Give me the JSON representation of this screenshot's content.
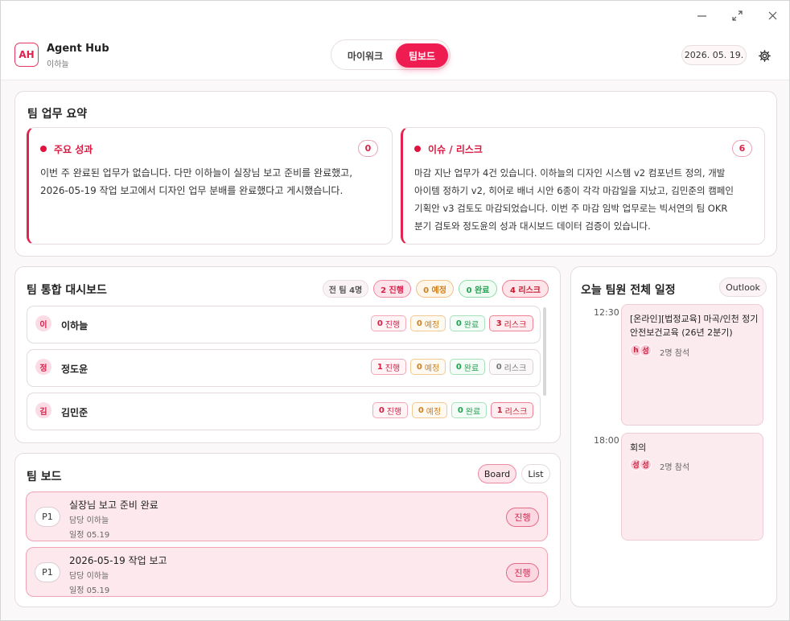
{
  "window": {
    "min_icon": "minimize-icon",
    "max_icon": "maximize-icon",
    "close_icon": "close-icon"
  },
  "header": {
    "logo": "AH",
    "app_name": "Agent Hub",
    "user_name": "이하늘",
    "tabs": [
      {
        "label": "마이워크",
        "active": false
      },
      {
        "label": "팀보드",
        "active": true
      }
    ],
    "date": "2026. 05. 19.",
    "settings_icon": "gear-icon"
  },
  "summary": {
    "title": "팀 업무 요약",
    "achievements": {
      "title": "주요 성과",
      "count": "0",
      "lines": [
        "이번 주 완료된 업무가 없습니다. 다만 이하늘이 실장님 보고 준비를 완료했고,",
        "2026-05-19 작업 보고에서 디자인 업무 분배를 완료했다고 게시했습니다."
      ]
    },
    "issues": {
      "title": "이슈 / 리스크",
      "count": "6",
      "lines": [
        "마감 지난 업무가 4건 있습니다. 이하늘의 디자인 시스템 v2 컴포넌트 정의, 개발",
        "아이템 정하기 v2, 히어로 배너 시안 6종이 각각 마감일을 지났고, 김민준의 캠페인",
        "기획안 v3 검토도 마감되었습니다. 이번 주 마감 임박 업무로는 빅서연의 팀 OKR",
        "분기 검토와 정도윤의 성과 대시보드 데이터 검증이 있습니다."
      ]
    }
  },
  "dashboard": {
    "title": "팀 통합 대시보드",
    "filters": {
      "team": "전 팀 4명",
      "progress": "2 진행",
      "planned": "0 예정",
      "done": "0 완료",
      "risk": "4 리스크"
    },
    "labels": {
      "progress": "진행",
      "planned": "예정",
      "done": "완료",
      "risk": "리스크"
    },
    "members": [
      {
        "initial": "이",
        "name": "이하늘",
        "progress": "0",
        "planned": "0",
        "done": "0",
        "risk": "3"
      },
      {
        "initial": "정",
        "name": "정도윤",
        "progress": "1",
        "planned": "0",
        "done": "0",
        "risk": "0"
      },
      {
        "initial": "김",
        "name": "김민준",
        "progress": "0",
        "planned": "0",
        "done": "0",
        "risk": "1"
      }
    ]
  },
  "board": {
    "title": "팀 보드",
    "views": [
      "Board",
      "List"
    ],
    "tasks": [
      {
        "priority": "P1",
        "title": "실장님 보고 준비 완료",
        "owner": "담당 이하늘",
        "due": "일정 05.19",
        "status": "진행"
      },
      {
        "priority": "P1",
        "title": "2026-05-19 작업 보고",
        "owner": "담당 이하늘",
        "due": "일정 05.19",
        "status": "진행"
      }
    ]
  },
  "schedule": {
    "title": "오늘 팀원 전체 일정",
    "source_button": "Outlook",
    "events": [
      {
        "time": "12:30",
        "title_lines": [
          "[온라인][법정교육] 마곡/인천 정기",
          "안전보건교육 (26년 2분기)"
        ],
        "avatars": [
          "h",
          "성"
        ],
        "attendees": "2명 참석"
      },
      {
        "time": "18:00",
        "title_lines": [
          "회의"
        ],
        "avatars": [
          "성",
          "성"
        ],
        "attendees": "2명 참석"
      }
    ]
  },
  "colors": {
    "accent": "#ef1c52",
    "risk": "#e0133f"
  }
}
